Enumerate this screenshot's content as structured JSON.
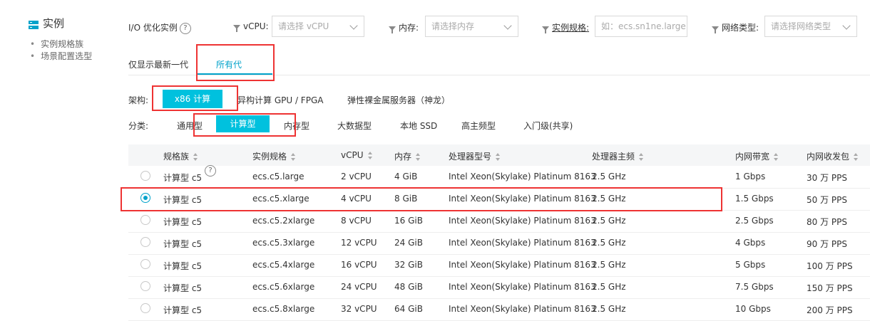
{
  "sidebar": {
    "title": "实例",
    "items": [
      "实例规格族",
      "场景配置选型"
    ]
  },
  "filters": {
    "io_optimized": "I/O 优化实例",
    "help_glyph": "?",
    "vcpu_label": "vCPU:",
    "vcpu_placeholder": "请选择 vCPU",
    "memory_label": "内存:",
    "memory_placeholder": "请选择内存",
    "spec_label": "实例规格:",
    "spec_placeholder": "如：ecs.sn1ne.large",
    "network_label": "网络类型:",
    "network_placeholder": "请选择网络类型"
  },
  "tabs": [
    "仅显示最新一代",
    "所有代"
  ],
  "architecture": {
    "label": "架构:",
    "options": [
      "x86 计算",
      "异构计算 GPU / FPGA",
      "弹性裸金属服务器（神龙）"
    ]
  },
  "category": {
    "label": "分类:",
    "options": [
      "通用型",
      "计算型",
      "内存型",
      "大数据型",
      "本地 SSD",
      "高主频型",
      "入门级(共享)"
    ]
  },
  "table": {
    "headers": [
      "规格族",
      "实例规格",
      "vCPU",
      "内存",
      "处理器型号",
      "处理器主频",
      "内网带宽",
      "内网收发包"
    ],
    "selected_row": 1,
    "rows": [
      [
        "计算型 c5",
        "ecs.c5.large",
        "2 vCPU",
        "4 GiB",
        "Intel Xeon(Skylake) Platinum 8163",
        "2.5 GHz",
        "1 Gbps",
        "30 万 PPS"
      ],
      [
        "计算型 c5",
        "ecs.c5.xlarge",
        "4 vCPU",
        "8 GiB",
        "Intel Xeon(Skylake) Platinum 8163",
        "2.5 GHz",
        "1.5 Gbps",
        "50 万 PPS"
      ],
      [
        "计算型 c5",
        "ecs.c5.2xlarge",
        "8 vCPU",
        "16 GiB",
        "Intel Xeon(Skylake) Platinum 8163",
        "2.5 GHz",
        "2.5 Gbps",
        "80 万 PPS"
      ],
      [
        "计算型 c5",
        "ecs.c5.3xlarge",
        "12 vCPU",
        "24 GiB",
        "Intel Xeon(Skylake) Platinum 8163",
        "2.5 GHz",
        "4 Gbps",
        "90 万 PPS"
      ],
      [
        "计算型 c5",
        "ecs.c5.4xlarge",
        "16 vCPU",
        "32 GiB",
        "Intel Xeon(Skylake) Platinum 8163",
        "2.5 GHz",
        "5 Gbps",
        "100 万 PPS"
      ],
      [
        "计算型 c5",
        "ecs.c5.6xlarge",
        "24 vCPU",
        "48 GiB",
        "Intel Xeon(Skylake) Platinum 8163",
        "2.5 GHz",
        "7.5 Gbps",
        "150 万 PPS"
      ],
      [
        "计算型 c5",
        "ecs.c5.8xlarge",
        "32 vCPU",
        "64 GiB",
        "Intel Xeon(Skylake) Platinum 8163",
        "2.5 GHz",
        "10 Gbps",
        "200 万 PPS"
      ]
    ]
  },
  "colors": {
    "accent": "#00a2ca",
    "chip_active": "#00c1de",
    "highlight": "#e33333"
  }
}
